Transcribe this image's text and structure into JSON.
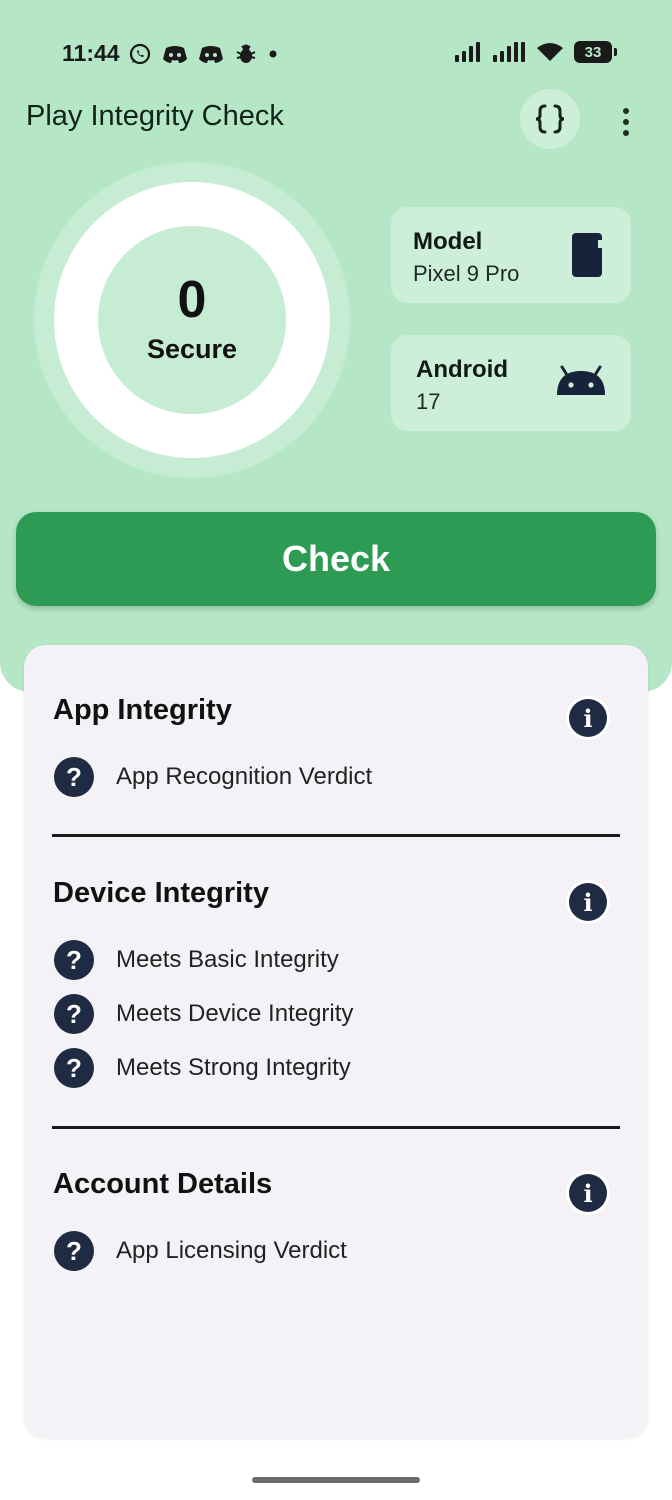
{
  "status_bar": {
    "time": "11:44",
    "battery": "33",
    "left_icons": [
      "whatsapp-icon",
      "discord-icon",
      "discord-icon",
      "bug-icon",
      "dot-icon"
    ],
    "right_icons": [
      "signal-icon",
      "signal-icon",
      "wifi-icon",
      "battery-icon"
    ]
  },
  "app_bar": {
    "title": "Play Integrity Check"
  },
  "score": {
    "value": "0",
    "label": "Secure"
  },
  "device": {
    "model_title": "Model",
    "model_value": "Pixel 9 Pro",
    "android_title": "Android",
    "android_value": "17"
  },
  "check_button": {
    "label": "Check"
  },
  "sections": [
    {
      "title": "App Integrity",
      "items": [
        "App Recognition Verdict"
      ]
    },
    {
      "title": "Device Integrity",
      "items": [
        "Meets Basic Integrity",
        "Meets Device Integrity",
        "Meets Strong Integrity"
      ]
    },
    {
      "title": "Account Details",
      "items": [
        "App Licensing Verdict"
      ]
    }
  ],
  "colors": {
    "header_bg": "#b5e6c6",
    "accent": "#2e9b55",
    "card_bg": "#cdeed9",
    "icon_navy": "#1e2b42"
  }
}
